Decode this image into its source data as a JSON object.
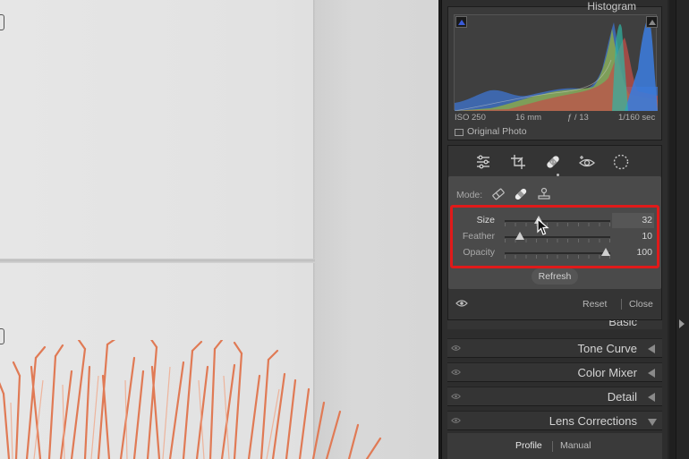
{
  "histogram": {
    "title": "Histogram",
    "iso": "ISO 250",
    "focal_length": "16 mm",
    "aperture": "ƒ / 13",
    "shutter": "1/160 sec",
    "original_photo_label": "Original Photo"
  },
  "tools": {
    "icons": [
      "edit-sliders-icon",
      "crop-icon",
      "healing-bandage-icon",
      "red-eye-icon",
      "masking-icon"
    ],
    "active": "healing-bandage-icon"
  },
  "healing": {
    "mode_label": "Mode:",
    "mode_icons": [
      "content-aware-remove-icon",
      "heal-icon",
      "clone-stamp-icon"
    ],
    "sliders": [
      {
        "label": "Size",
        "value": "32",
        "fraction": 0.32
      },
      {
        "label": "Feather",
        "value": "10",
        "fraction": 0.1
      },
      {
        "label": "Opacity",
        "value": "100",
        "fraction": 1.0
      }
    ],
    "refresh_label": "Refresh",
    "reset_label": "Reset",
    "close_label": "Close"
  },
  "sections": {
    "basic": "Basic",
    "tone_curve": "Tone Curve",
    "color_mixer": "Color Mixer",
    "detail": "Detail",
    "lens_corrections": "Lens Corrections"
  },
  "lens_tabs": {
    "profile": "Profile",
    "manual": "Manual",
    "active": "Profile"
  },
  "colors": {
    "highlight": "#e01a1a",
    "panel": "#2d2d2d"
  }
}
